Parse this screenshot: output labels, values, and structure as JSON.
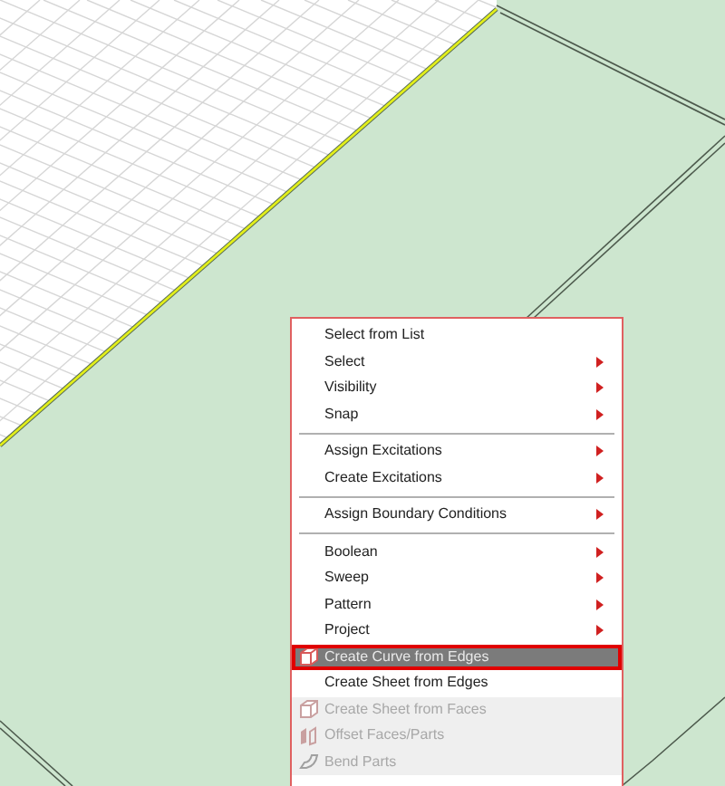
{
  "context_menu": {
    "items": [
      {
        "kind": "item",
        "label": "Select from List",
        "submenu": false,
        "disabled": false,
        "selected": false
      },
      {
        "kind": "item",
        "label": "Select",
        "submenu": true,
        "disabled": false,
        "selected": false
      },
      {
        "kind": "item",
        "label": "Visibility",
        "submenu": true,
        "disabled": false,
        "selected": false
      },
      {
        "kind": "item",
        "label": "Snap",
        "submenu": true,
        "disabled": false,
        "selected": false
      },
      {
        "kind": "separator"
      },
      {
        "kind": "item",
        "label": "Assign Excitations",
        "submenu": true,
        "disabled": false,
        "selected": false
      },
      {
        "kind": "item",
        "label": "Create Excitations",
        "submenu": true,
        "disabled": false,
        "selected": false
      },
      {
        "kind": "separator"
      },
      {
        "kind": "item",
        "label": "Assign Boundary Conditions",
        "submenu": true,
        "disabled": false,
        "selected": false
      },
      {
        "kind": "separator"
      },
      {
        "kind": "item",
        "label": "Boolean",
        "submenu": true,
        "disabled": false,
        "selected": false
      },
      {
        "kind": "item",
        "label": "Sweep",
        "submenu": true,
        "disabled": false,
        "selected": false
      },
      {
        "kind": "item",
        "label": "Pattern",
        "submenu": true,
        "disabled": false,
        "selected": false
      },
      {
        "kind": "item",
        "label": "Project",
        "submenu": true,
        "disabled": false,
        "selected": false
      },
      {
        "kind": "cube-item",
        "label": "Create Curve from Edges",
        "submenu": false,
        "disabled": false,
        "selected": true
      },
      {
        "kind": "item",
        "label": "Create Sheet from Edges",
        "submenu": false,
        "disabled": false,
        "selected": false
      },
      {
        "kind": "cube-item",
        "label": "Create Sheet from Faces",
        "submenu": false,
        "disabled": true,
        "selected": false
      },
      {
        "kind": "faces-item",
        "label": "Offset Faces/Parts",
        "submenu": false,
        "disabled": true,
        "selected": false
      },
      {
        "kind": "bend-item",
        "label": "Bend Parts",
        "submenu": false,
        "disabled": true,
        "selected": false
      }
    ]
  }
}
